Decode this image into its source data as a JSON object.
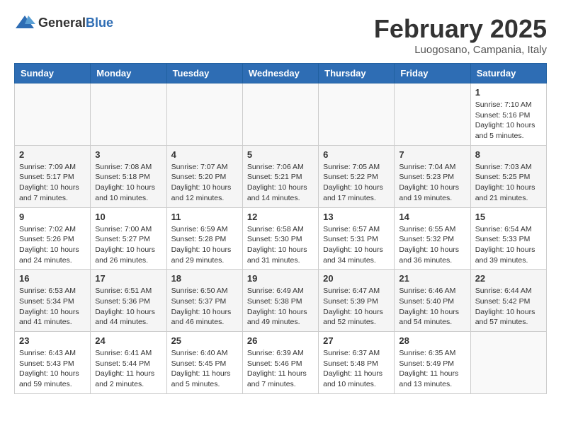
{
  "header": {
    "logo_general": "General",
    "logo_blue": "Blue",
    "title": "February 2025",
    "subtitle": "Luogosano, Campania, Italy"
  },
  "days_of_week": [
    "Sunday",
    "Monday",
    "Tuesday",
    "Wednesday",
    "Thursday",
    "Friday",
    "Saturday"
  ],
  "weeks": [
    {
      "days": [
        {
          "num": "",
          "info": ""
        },
        {
          "num": "",
          "info": ""
        },
        {
          "num": "",
          "info": ""
        },
        {
          "num": "",
          "info": ""
        },
        {
          "num": "",
          "info": ""
        },
        {
          "num": "",
          "info": ""
        },
        {
          "num": "1",
          "info": "Sunrise: 7:10 AM\nSunset: 5:16 PM\nDaylight: 10 hours\nand 5 minutes."
        }
      ]
    },
    {
      "days": [
        {
          "num": "2",
          "info": "Sunrise: 7:09 AM\nSunset: 5:17 PM\nDaylight: 10 hours\nand 7 minutes."
        },
        {
          "num": "3",
          "info": "Sunrise: 7:08 AM\nSunset: 5:18 PM\nDaylight: 10 hours\nand 10 minutes."
        },
        {
          "num": "4",
          "info": "Sunrise: 7:07 AM\nSunset: 5:20 PM\nDaylight: 10 hours\nand 12 minutes."
        },
        {
          "num": "5",
          "info": "Sunrise: 7:06 AM\nSunset: 5:21 PM\nDaylight: 10 hours\nand 14 minutes."
        },
        {
          "num": "6",
          "info": "Sunrise: 7:05 AM\nSunset: 5:22 PM\nDaylight: 10 hours\nand 17 minutes."
        },
        {
          "num": "7",
          "info": "Sunrise: 7:04 AM\nSunset: 5:23 PM\nDaylight: 10 hours\nand 19 minutes."
        },
        {
          "num": "8",
          "info": "Sunrise: 7:03 AM\nSunset: 5:25 PM\nDaylight: 10 hours\nand 21 minutes."
        }
      ]
    },
    {
      "days": [
        {
          "num": "9",
          "info": "Sunrise: 7:02 AM\nSunset: 5:26 PM\nDaylight: 10 hours\nand 24 minutes."
        },
        {
          "num": "10",
          "info": "Sunrise: 7:00 AM\nSunset: 5:27 PM\nDaylight: 10 hours\nand 26 minutes."
        },
        {
          "num": "11",
          "info": "Sunrise: 6:59 AM\nSunset: 5:28 PM\nDaylight: 10 hours\nand 29 minutes."
        },
        {
          "num": "12",
          "info": "Sunrise: 6:58 AM\nSunset: 5:30 PM\nDaylight: 10 hours\nand 31 minutes."
        },
        {
          "num": "13",
          "info": "Sunrise: 6:57 AM\nSunset: 5:31 PM\nDaylight: 10 hours\nand 34 minutes."
        },
        {
          "num": "14",
          "info": "Sunrise: 6:55 AM\nSunset: 5:32 PM\nDaylight: 10 hours\nand 36 minutes."
        },
        {
          "num": "15",
          "info": "Sunrise: 6:54 AM\nSunset: 5:33 PM\nDaylight: 10 hours\nand 39 minutes."
        }
      ]
    },
    {
      "days": [
        {
          "num": "16",
          "info": "Sunrise: 6:53 AM\nSunset: 5:34 PM\nDaylight: 10 hours\nand 41 minutes."
        },
        {
          "num": "17",
          "info": "Sunrise: 6:51 AM\nSunset: 5:36 PM\nDaylight: 10 hours\nand 44 minutes."
        },
        {
          "num": "18",
          "info": "Sunrise: 6:50 AM\nSunset: 5:37 PM\nDaylight: 10 hours\nand 46 minutes."
        },
        {
          "num": "19",
          "info": "Sunrise: 6:49 AM\nSunset: 5:38 PM\nDaylight: 10 hours\nand 49 minutes."
        },
        {
          "num": "20",
          "info": "Sunrise: 6:47 AM\nSunset: 5:39 PM\nDaylight: 10 hours\nand 52 minutes."
        },
        {
          "num": "21",
          "info": "Sunrise: 6:46 AM\nSunset: 5:40 PM\nDaylight: 10 hours\nand 54 minutes."
        },
        {
          "num": "22",
          "info": "Sunrise: 6:44 AM\nSunset: 5:42 PM\nDaylight: 10 hours\nand 57 minutes."
        }
      ]
    },
    {
      "days": [
        {
          "num": "23",
          "info": "Sunrise: 6:43 AM\nSunset: 5:43 PM\nDaylight: 10 hours\nand 59 minutes."
        },
        {
          "num": "24",
          "info": "Sunrise: 6:41 AM\nSunset: 5:44 PM\nDaylight: 11 hours\nand 2 minutes."
        },
        {
          "num": "25",
          "info": "Sunrise: 6:40 AM\nSunset: 5:45 PM\nDaylight: 11 hours\nand 5 minutes."
        },
        {
          "num": "26",
          "info": "Sunrise: 6:39 AM\nSunset: 5:46 PM\nDaylight: 11 hours\nand 7 minutes."
        },
        {
          "num": "27",
          "info": "Sunrise: 6:37 AM\nSunset: 5:48 PM\nDaylight: 11 hours\nand 10 minutes."
        },
        {
          "num": "28",
          "info": "Sunrise: 6:35 AM\nSunset: 5:49 PM\nDaylight: 11 hours\nand 13 minutes."
        },
        {
          "num": "",
          "info": ""
        }
      ]
    }
  ]
}
